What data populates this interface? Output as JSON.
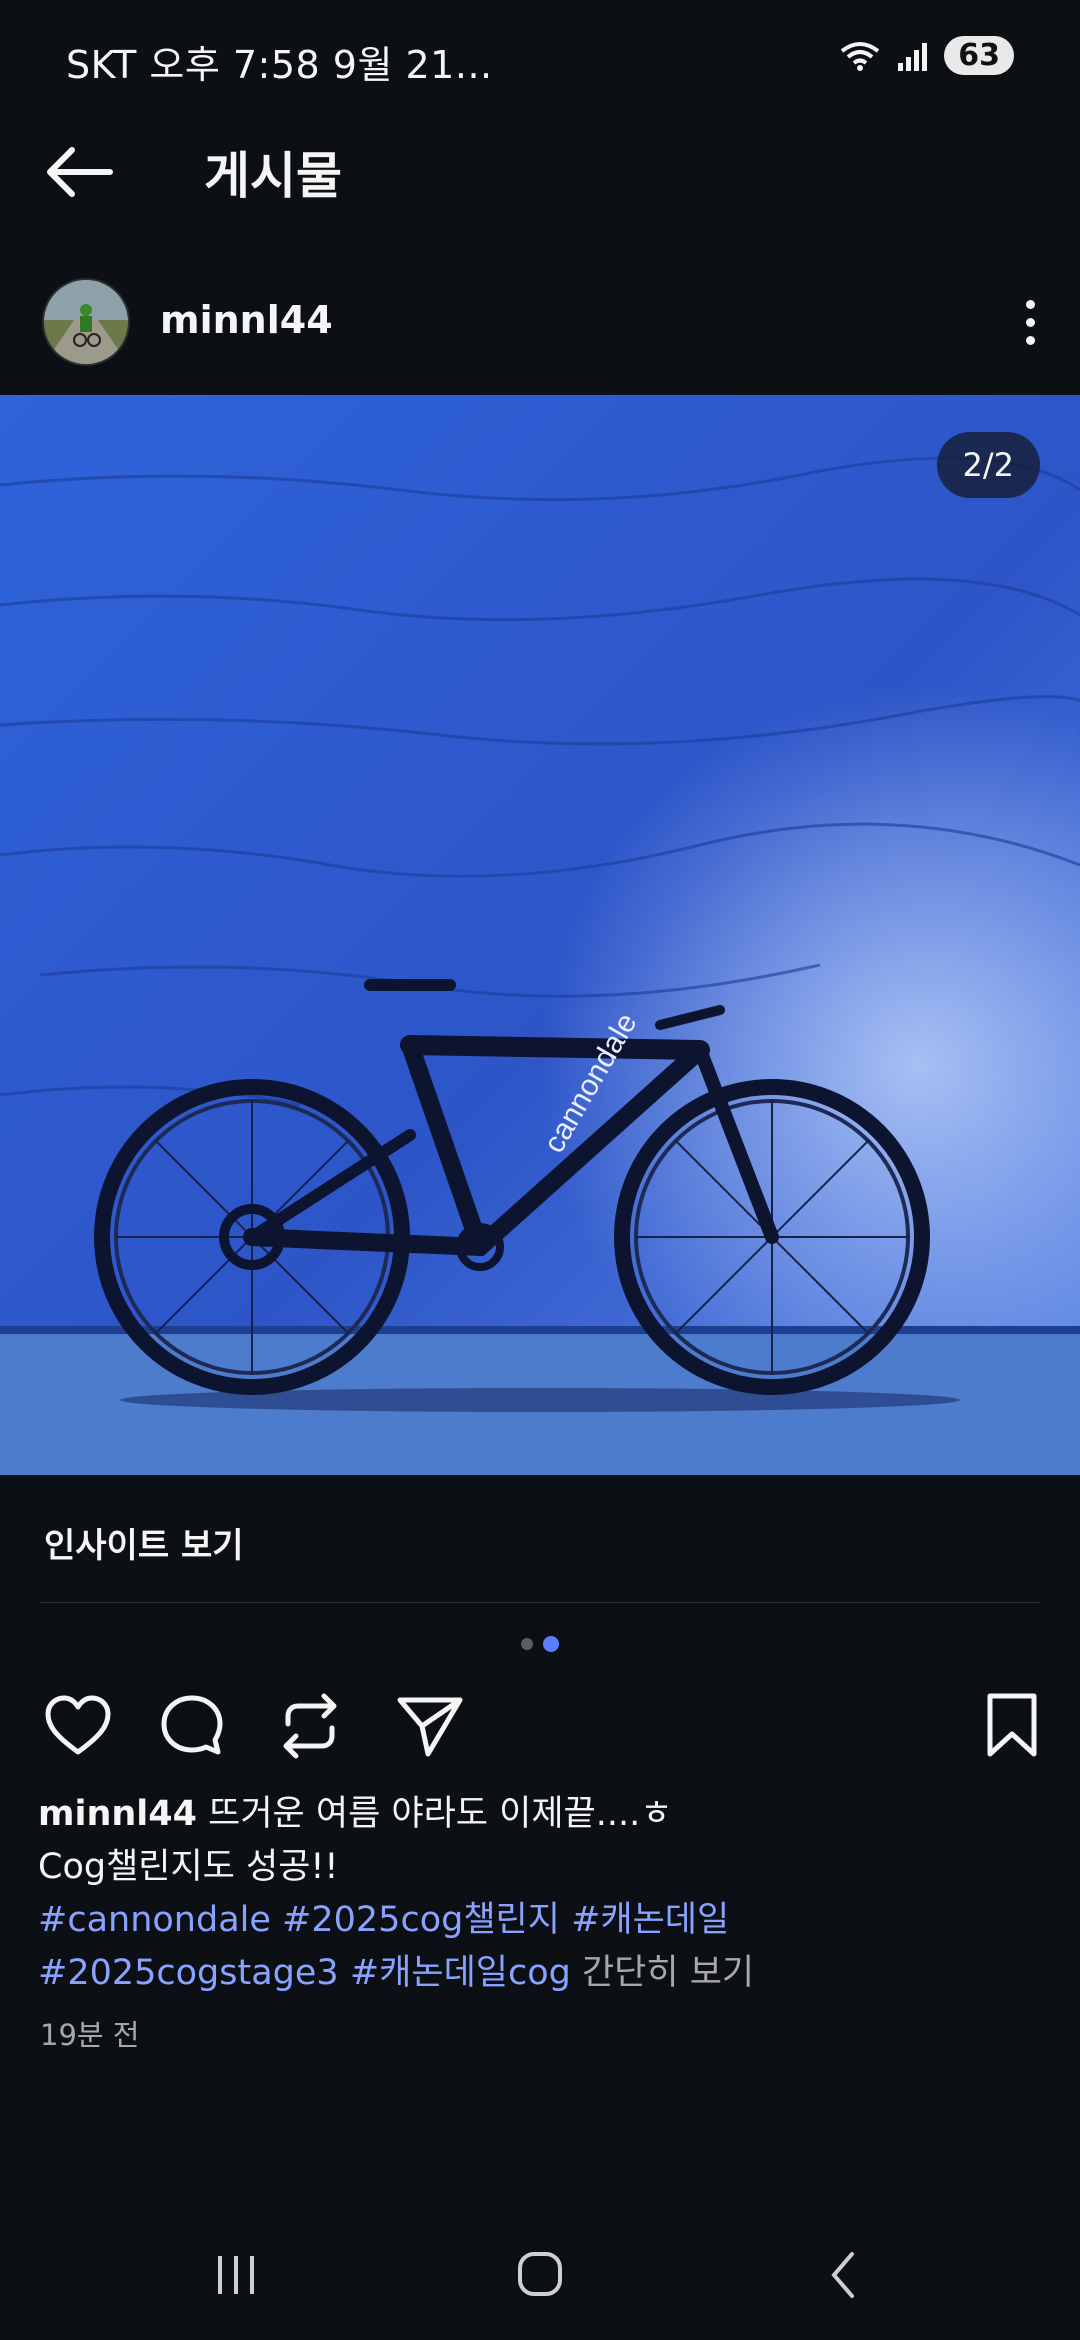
{
  "status_bar": {
    "carrier_time": "SKT 오후 7:58  9월 21...",
    "battery": "63"
  },
  "header": {
    "title": "게시물"
  },
  "post": {
    "username": "minnl44",
    "counter": "2/2",
    "brand_on_frame": "cannondale",
    "insights": "인사이트 보기",
    "caption_text_1": "뜨거운 여름 야라도 이제끝....ㅎ",
    "caption_text_2": "Cog챌린지도 성공!!",
    "tags": [
      "#cannondale",
      "#2025cog챌린지",
      "#캐논데일",
      "#2025cogstage3",
      "#캐논데일cog"
    ],
    "more_label": "간단히 보기",
    "time": "19분 전"
  },
  "colors": {
    "background": "#0c1014",
    "accent": "#5b7dff",
    "hashtag": "#8aa2ff",
    "image_blue": "#2e5fd8"
  },
  "icons": [
    "back-arrow-icon",
    "wifi-icon",
    "signal-icon",
    "more-vertical-icon",
    "heart-icon",
    "comment-icon",
    "repost-icon",
    "send-icon",
    "bookmark-icon",
    "recent-apps-icon",
    "home-icon",
    "nav-back-icon"
  ]
}
